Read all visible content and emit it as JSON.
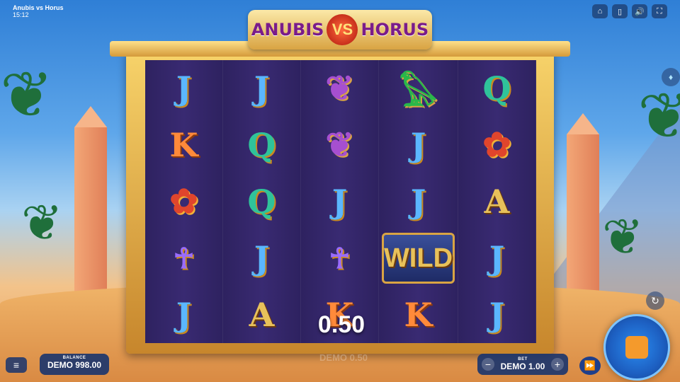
{
  "window": {
    "title": "Anubis vs Horus",
    "time": "15:12"
  },
  "top_buttons": [
    {
      "name": "home-icon",
      "glyph": "⌂"
    },
    {
      "name": "paytable-icon",
      "glyph": "▯"
    },
    {
      "name": "sound-icon",
      "glyph": "🔊"
    },
    {
      "name": "fullscreen-icon",
      "glyph": "⛶"
    }
  ],
  "logo": {
    "left": "ANUBIS",
    "vs": "VS",
    "right": "HORUS"
  },
  "reels": [
    [
      {
        "type": "J",
        "glyph": "J"
      },
      {
        "type": "K",
        "glyph": "K"
      },
      {
        "type": "scarab",
        "glyph": "✿"
      },
      {
        "type": "ankh",
        "glyph": "☥"
      },
      {
        "type": "J",
        "glyph": "J"
      }
    ],
    [
      {
        "type": "J",
        "glyph": "J"
      },
      {
        "type": "Q",
        "glyph": "Q"
      },
      {
        "type": "Q",
        "glyph": "Q"
      },
      {
        "type": "J",
        "glyph": "J"
      },
      {
        "type": "A",
        "glyph": "A"
      }
    ],
    [
      {
        "type": "lotus",
        "glyph": "❦"
      },
      {
        "type": "lotus",
        "glyph": "❦"
      },
      {
        "type": "J",
        "glyph": "J"
      },
      {
        "type": "ankh",
        "glyph": "☥"
      },
      {
        "type": "K",
        "glyph": "K"
      }
    ],
    [
      {
        "type": "bird",
        "glyph": "𓅃"
      },
      {
        "type": "J",
        "glyph": "J"
      },
      {
        "type": "J",
        "glyph": "J"
      },
      {
        "type": "wild",
        "glyph": "WILD"
      },
      {
        "type": "K",
        "glyph": "K"
      }
    ],
    [
      {
        "type": "Q",
        "glyph": "Q"
      },
      {
        "type": "scarab",
        "glyph": "✿"
      },
      {
        "type": "A",
        "glyph": "A"
      },
      {
        "type": "J",
        "glyph": "J"
      },
      {
        "type": "J",
        "glyph": "J"
      }
    ]
  ],
  "win_amount": "0.50",
  "balance": {
    "label": "BALANCE",
    "value": "DEMO 998.00"
  },
  "bet": {
    "label": "BET",
    "value": "DEMO 1.00",
    "minus": "−",
    "plus": "+"
  },
  "controls": {
    "menu": "≡",
    "turbo": "⏩",
    "autoplay": "↻",
    "gem": "♦"
  },
  "ghost_text": "DEMO 0.50"
}
